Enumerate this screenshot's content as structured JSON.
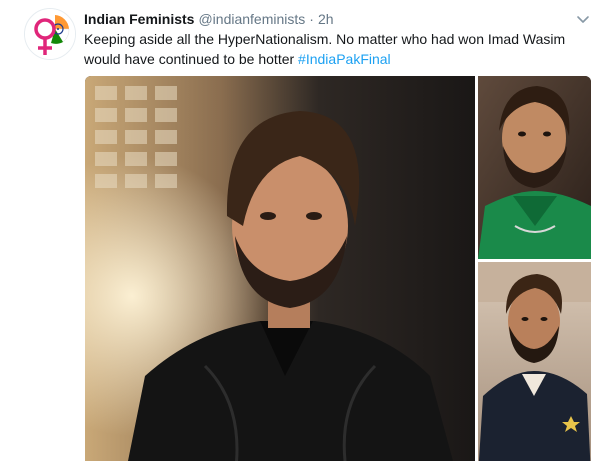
{
  "tweet": {
    "display_name": "Indian Feminists",
    "handle": "@indianfeminists",
    "separator": "·",
    "timestamp": "2h",
    "text": "Keeping aside all the HyperNationalism. No matter who had won Imad Wasim would have continued to be hotter",
    "hashtag": "#IndiaPakFinal"
  },
  "icons": {
    "avatar": "feminist-venus-logo",
    "menu": "chevron-down-icon"
  },
  "colors": {
    "link": "#1da1f2",
    "text": "#14171a",
    "muted": "#657786",
    "logo_pink": "#e0267a",
    "logo_saffron": "#ff9933",
    "logo_green": "#138808",
    "logo_blue": "#1b3a8c"
  }
}
